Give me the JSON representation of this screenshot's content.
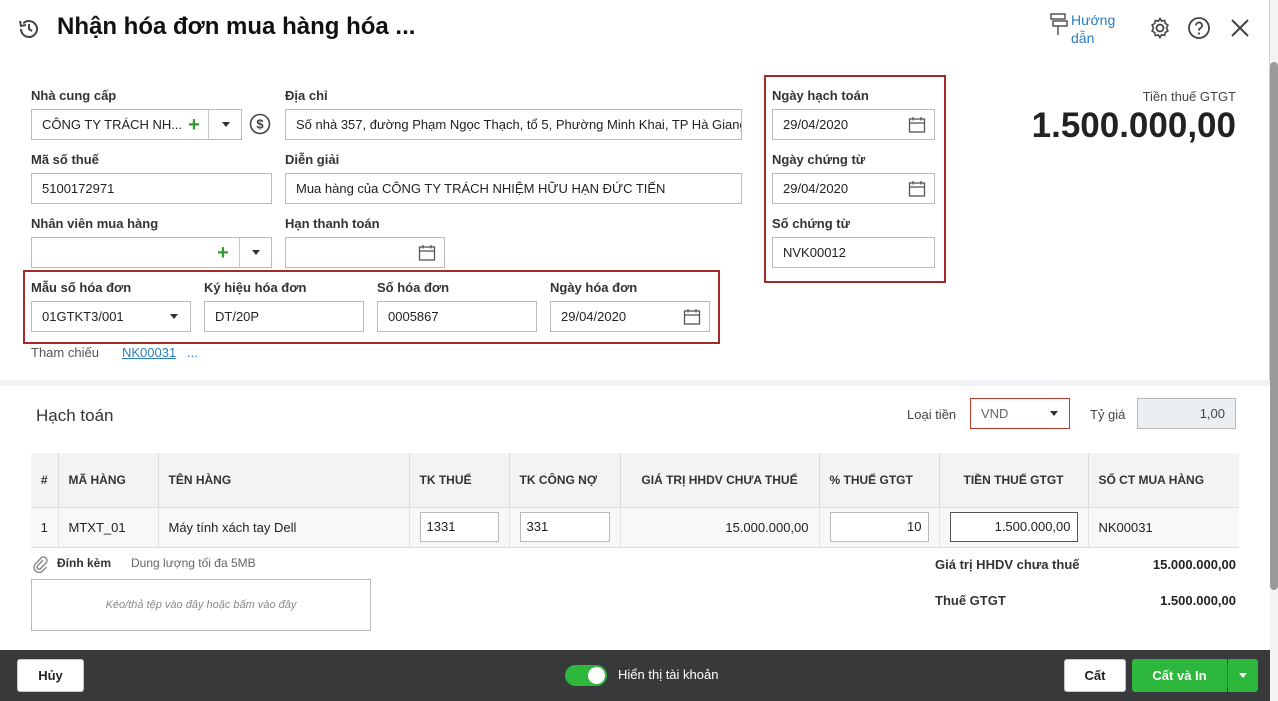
{
  "header": {
    "title": "Nhận hóa đơn mua hàng hóa ...",
    "help_line1": "Hướng",
    "help_line2": "dẫn"
  },
  "form": {
    "supplier_label": "Nhà cung cấp",
    "supplier_value": "CÔNG TY TRÁCH NH...",
    "address_label": "Địa chỉ",
    "address_value": "Số nhà 357, đường Phạm Ngọc Thạch, tổ 5, Phường Minh Khai, TP Hà Giang",
    "tax_code_label": "Mã số thuế",
    "tax_code_value": "5100172971",
    "description_label": "Diễn giải",
    "description_value": "Mua hàng của CÔNG TY TRÁCH NHIỆM HỮU HẠN  ĐỨC TIẾN",
    "buyer_label": "Nhân viên mua hàng",
    "buyer_value": "",
    "due_label": "Hạn thanh toán",
    "due_value": "",
    "invoice_template_label": "Mẫu số hóa đơn",
    "invoice_template_value": "01GTKT3/001",
    "invoice_symbol_label": "Ký hiệu hóa đơn",
    "invoice_symbol_value": "DT/20P",
    "invoice_no_label": "Số hóa đơn",
    "invoice_no_value": "0005867",
    "invoice_date_label": "Ngày hóa đơn",
    "invoice_date_value": "29/04/2020",
    "reference_label": "Tham chiếu",
    "reference_link": "NK00031",
    "reference_more": "...",
    "posting_date_label": "Ngày hạch toán",
    "posting_date_value": "29/04/2020",
    "voucher_date_label": "Ngày chứng từ",
    "voucher_date_value": "29/04/2020",
    "voucher_no_label": "Số chứng từ",
    "voucher_no_value": "NVK00012",
    "vat_total_label": "Tiền thuế GTGT",
    "vat_total_value": "1.500.000,00"
  },
  "accounting": {
    "section_title": "Hạch toán",
    "currency_label": "Loại tiền",
    "currency_value": "VND",
    "rate_label": "Tỷ giá",
    "rate_value": "1,00",
    "columns": [
      "#",
      "MÃ HÀNG",
      "TÊN HÀNG",
      "TK THUẾ",
      "TK CÔNG NỢ",
      "GIÁ TRỊ HHDV CHƯA THUẾ",
      "% THUẾ GTGT",
      "TIỀN THUẾ GTGT",
      "SỐ CT MUA HÀNG"
    ],
    "rows": [
      {
        "no": "1",
        "code": "MTXT_01",
        "name": "Máy tính xách tay Dell",
        "tax_account": "1331",
        "debt_account": "331",
        "amount": "15.000.000,00",
        "vat_rate": "10",
        "vat_amount": "1.500.000,00",
        "purchase_voucher": "NK00031"
      }
    ]
  },
  "attachment": {
    "label": "Đính kèm",
    "hint": "Dung lượng tối đa 5MB",
    "dropzone": "Kéo/thả tệp vào đây hoặc bấm vào đây"
  },
  "summary": {
    "subtotal_label": "Giá trị HHDV chưa thuế",
    "subtotal_value": "15.000.000,00",
    "vat_label": "Thuế GTGT",
    "vat_value": "1.500.000,00"
  },
  "footer": {
    "cancel": "Hủy",
    "toggle_label": "Hiển thị tài khoản",
    "toggle_on": true,
    "save": "Cất",
    "save_print": "Cất và In"
  },
  "colors": {
    "accent_green": "#2db83d",
    "highlight_red": "#a52a2a",
    "link_blue": "#2d7dbf",
    "footer_bg": "#38393b"
  }
}
